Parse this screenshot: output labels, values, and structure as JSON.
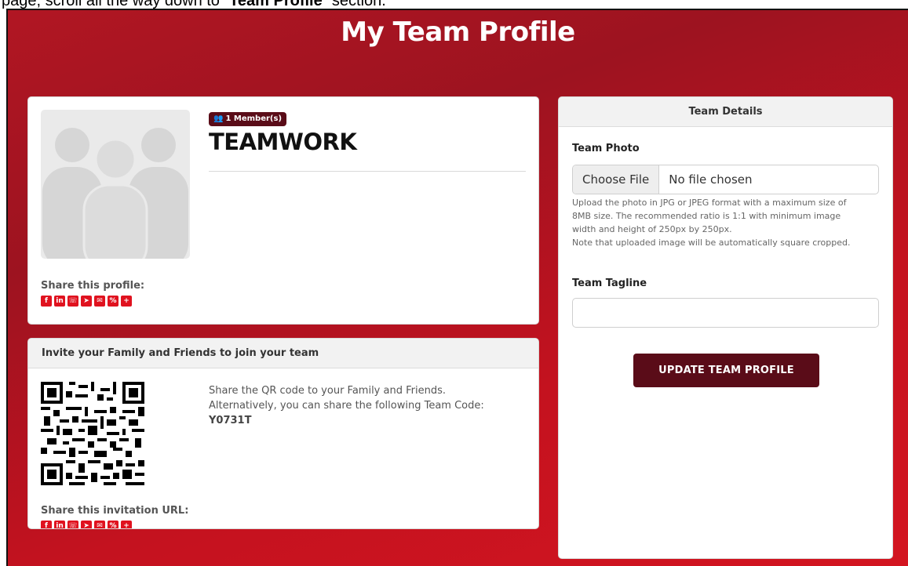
{
  "caption": {
    "prefix": "page, scroll all the way down to “",
    "bold": "Team Profile",
    "suffix": "” section."
  },
  "page": {
    "title": "My Team Profile"
  },
  "profile": {
    "member_badge": "1 Member(s)",
    "team_name": "TEAMWORK",
    "share_label": "Share this profile:",
    "share_icons": [
      "facebook-icon",
      "linkedin-icon",
      "whatsapp-icon",
      "telegram-icon",
      "email-icon",
      "link-icon",
      "plus-icon"
    ]
  },
  "invite": {
    "header": "Invite your Family and Friends to join your team",
    "line1": "Share the QR code to your Family and Friends.",
    "line2": "Alternatively, you can share the following Team Code:",
    "team_code": "Y0731T",
    "share_label": "Share this invitation URL:"
  },
  "details": {
    "header": "Team Details",
    "photo_label": "Team Photo",
    "file_button": "Choose File",
    "file_status": "No file chosen",
    "help_line1": "Upload the photo in JPG or JPEG format with a maximum size of",
    "help_line2": "8MB size. The recommended ratio is 1:1 with minimum image",
    "help_line3": "width and height of 250px by 250px.",
    "help_line4": "Note that uploaded image will be automatically square cropped.",
    "tagline_label": "Team Tagline",
    "tagline_value": "",
    "update_button": "UPDATE TEAM PROFILE"
  },
  "colors": {
    "brand_red": "#c4121f",
    "dark_maroon": "#5a0c18",
    "share_red": "#e0121f"
  }
}
